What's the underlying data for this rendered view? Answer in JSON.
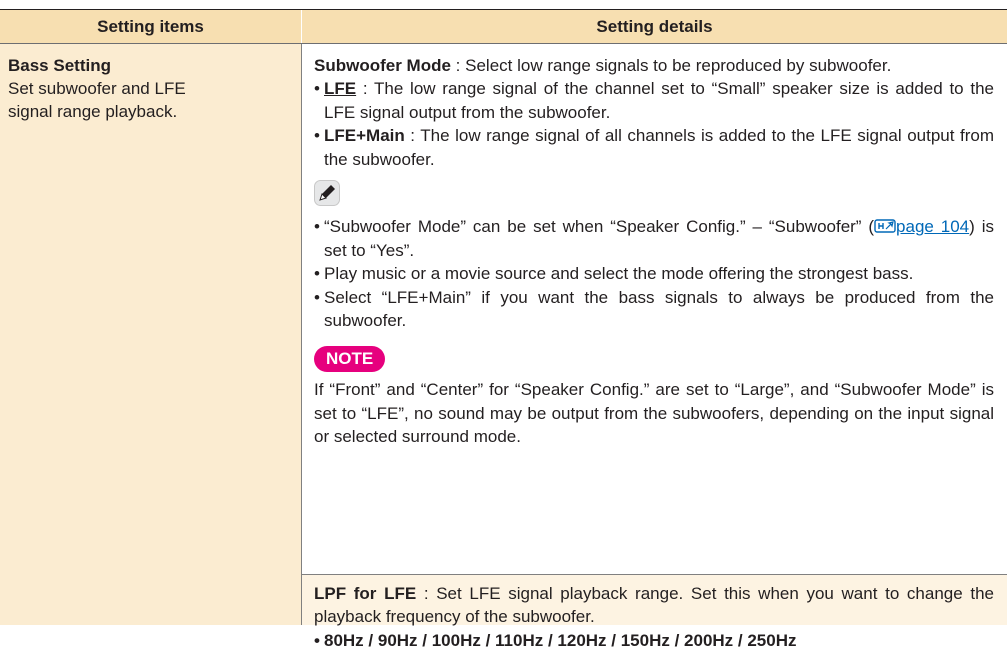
{
  "header": {
    "col1": "Setting items",
    "col2": "Setting details"
  },
  "left": {
    "title": "Bass Setting",
    "desc_line1": "Set subwoofer and LFE",
    "desc_line2": "signal range playback."
  },
  "content": {
    "mode_label": "Subwoofer Mode",
    "mode_text": " : Select low range signals to be reproduced by subwoofer.",
    "lfe_label": "LFE",
    "lfe_text": " : The low range signal of the channel set to “Small” speaker size is added to the LFE signal output from the subwoofer.",
    "lfemain_label": "LFE+Main",
    "lfemain_text": " : The low range signal of all channels is added to the LFE signal output from the subwoofer.",
    "tip1_a": "“Subwoofer Mode” can be set when “Speaker Config.” – “Subwoofer” (",
    "tip1_link": "page 104",
    "tip1_b": ") is set to “Yes”.",
    "tip2": "Play music or a movie source and select the mode offering the strongest bass.",
    "tip3": "Select “LFE+Main” if you want the bass signals to always be produced from the subwoofer.",
    "note_label": "NOTE",
    "note_text": "If “Front” and “Center” for “Speaker Config.” are set to “Large”, and “Subwoofer Mode” is set to “LFE”, no sound may be output from the subwoofers, depending on the input signal or selected surround mode."
  },
  "lpf": {
    "label": "LPF for LFE",
    "text": " : Set LFE signal playback range. Set this when you want to change the playback frequency of the subwoofer.",
    "options": [
      "80Hz",
      "90Hz",
      "100Hz",
      "110Hz",
      "120Hz",
      "150Hz",
      "200Hz",
      "250Hz"
    ],
    "separator": " / "
  },
  "colors": {
    "header_bg": "#f7dfb1",
    "left_bg": "#fbecd1",
    "note_badge": "#e6007e",
    "link": "#0068b7"
  },
  "icons": [
    "pencil-note-icon",
    "page-reference-icon"
  ]
}
